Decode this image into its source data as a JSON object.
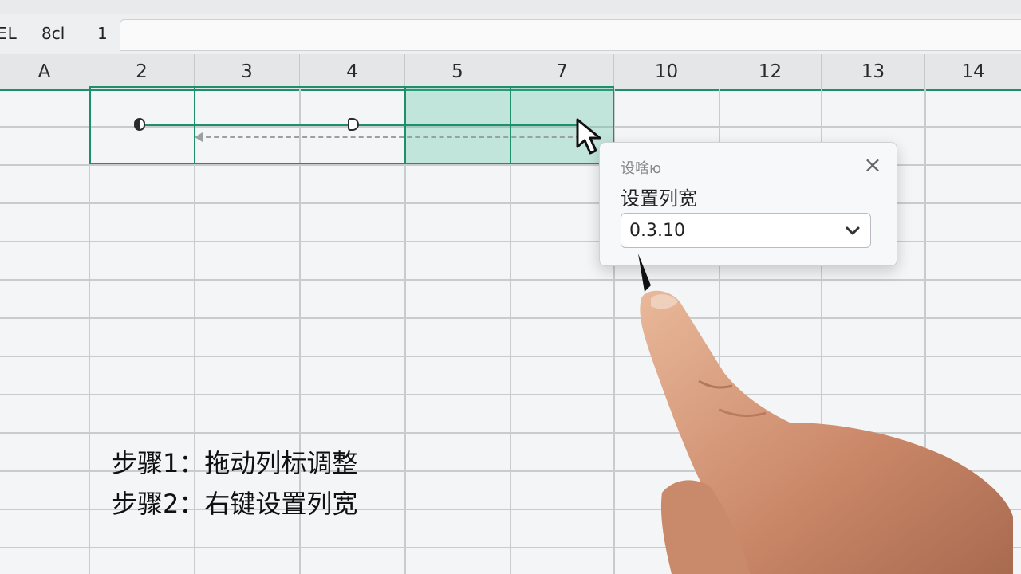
{
  "formula_bar": {
    "cell_ref": "EL",
    "fx_a": "8cl",
    "fx_b": "1"
  },
  "columns": [
    "A",
    "2",
    "3",
    "4",
    "5",
    "7",
    "10",
    "12",
    "13",
    "14"
  ],
  "dialog": {
    "title": "设啥ю",
    "label": "设置列宽",
    "value": "0.3.10",
    "close_icon": "close-icon",
    "dropdown_icon": "chevron-down-icon"
  },
  "captions": {
    "step1": "步骤1：拖动列标调整",
    "step2": "步骤2：右键设置列宽"
  },
  "colors": {
    "accent": "#1e8f6d",
    "selection_fill": "#b7e4d6"
  }
}
